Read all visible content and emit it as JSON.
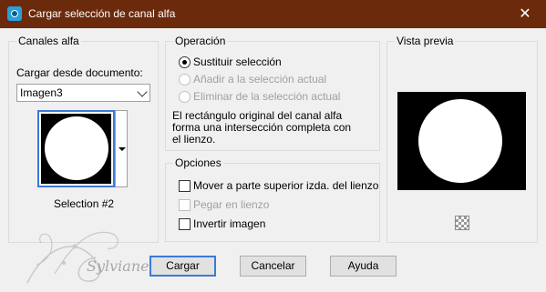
{
  "window": {
    "title": "Cargar selección de canal alfa",
    "close_glyph": "✕"
  },
  "canales": {
    "legend": "Canales alfa",
    "load_label": "Cargar desde documento:",
    "document_value": "Imagen3",
    "selection_label": "Selection #2"
  },
  "operacion": {
    "legend": "Operación",
    "options": [
      {
        "label": "Sustituir selección",
        "checked": true,
        "enabled": true
      },
      {
        "label": "Añadir a la selección actual",
        "checked": false,
        "enabled": false
      },
      {
        "label": "Eliminar de la selección actual",
        "checked": false,
        "enabled": false
      }
    ],
    "description": [
      "El rectángulo original del canal alfa",
      "forma una intersección completa con",
      "el lienzo."
    ]
  },
  "opciones": {
    "legend": "Opciones",
    "checks": [
      {
        "label": "Mover a parte superior izda. del lienzo",
        "checked": false,
        "enabled": true
      },
      {
        "label": "Pegar en lienzo",
        "checked": false,
        "enabled": false
      },
      {
        "label": "Invertir imagen",
        "checked": false,
        "enabled": true
      }
    ]
  },
  "vista_previa": {
    "legend": "Vista previa",
    "zoom_icon": "checker-icon"
  },
  "buttons": {
    "load": "Cargar",
    "cancel": "Cancelar",
    "help": "Ayuda"
  },
  "watermark": "Sylviane",
  "colors": {
    "titlebar": "#6b2a0c",
    "accent": "#3b7ad9",
    "dialog_bg": "#f0f0f0"
  }
}
